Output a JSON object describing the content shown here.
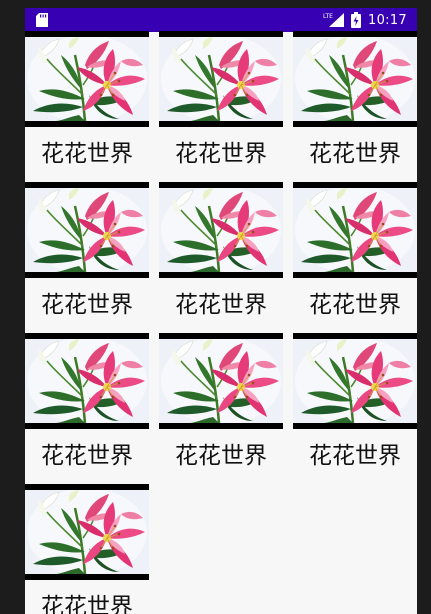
{
  "status_bar": {
    "time": "10:17",
    "network": "LTE",
    "icons": [
      "sd-card-icon",
      "lte-signal-icon",
      "battery-charging-icon"
    ],
    "background": "#3700b3"
  },
  "grid": {
    "columns": 3,
    "items": [
      {
        "label": "花花世界",
        "image": "lily-flower"
      },
      {
        "label": "花花世界",
        "image": "lily-flower"
      },
      {
        "label": "花花世界",
        "image": "lily-flower"
      },
      {
        "label": "花花世界",
        "image": "lily-flower"
      },
      {
        "label": "花花世界",
        "image": "lily-flower"
      },
      {
        "label": "花花世界",
        "image": "lily-flower"
      },
      {
        "label": "花花世界",
        "image": "lily-flower"
      },
      {
        "label": "花花世界",
        "image": "lily-flower"
      },
      {
        "label": "花花世界",
        "image": "lily-flower"
      },
      {
        "label": "花花世界",
        "image": "lily-flower"
      }
    ]
  }
}
